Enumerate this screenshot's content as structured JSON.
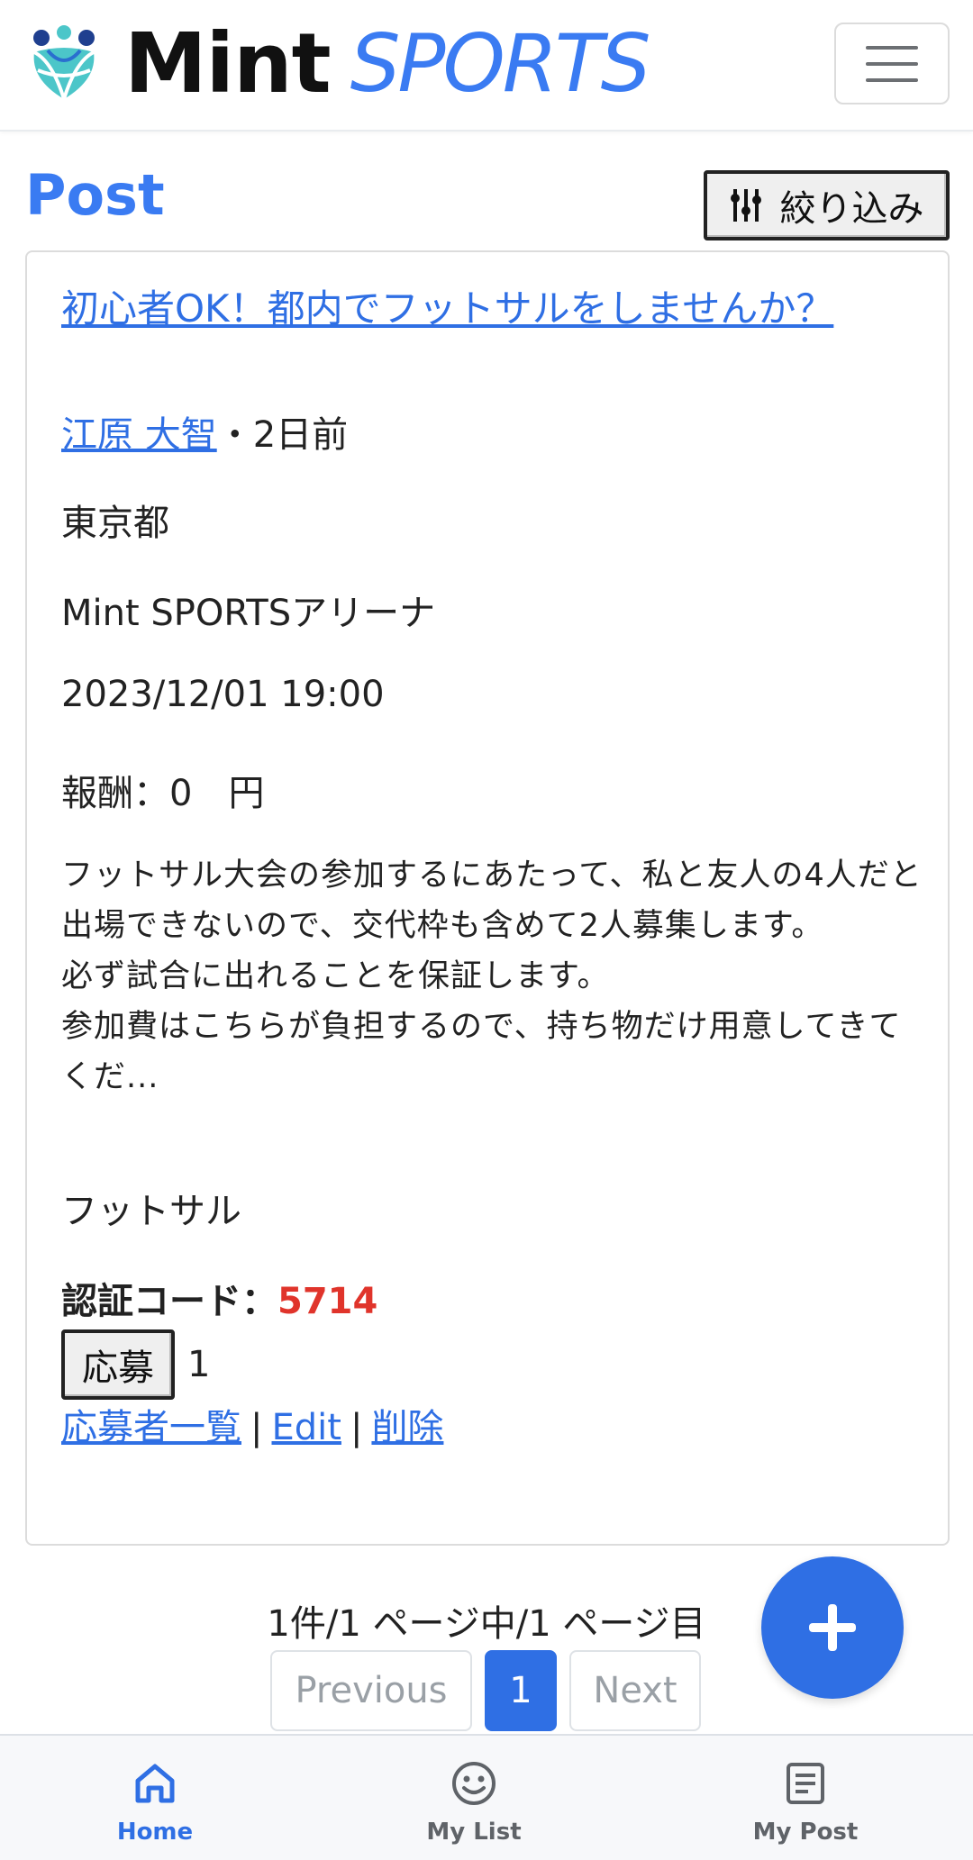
{
  "header": {
    "brand_mint": "Mint",
    "brand_sports": "SPORTS",
    "menu_icon": "hamburger-menu-icon"
  },
  "page": {
    "title": "Post",
    "filter_label": "絞り込み",
    "filter_icon": "sliders-icon"
  },
  "post": {
    "title": "初心者OK！都内でフットサルをしませんか？",
    "author": "江原 大智",
    "time_ago": "・2日前",
    "prefecture": "東京都",
    "venue": "Mint SPORTSアリーナ",
    "datetime": "2023/12/01 19:00",
    "reward": "報酬：0　円",
    "description": "フットサル大会の参加するにあたって、私と友人の4人だと出場できないので、交代枠も含めて2人募集します。\n必ず試合に出れることを保証します。\n参加費はこちらが負担するので、持ち物だけ用意してきてくだ...",
    "sport": "フットサル",
    "auth_label": "認証コード：",
    "auth_code": "5714",
    "apply_label": "応募",
    "apply_count": "1",
    "links": {
      "applicants": "応募者一覧",
      "sep1": "|",
      "edit": "Edit",
      "sep2": "|",
      "delete": "削除"
    }
  },
  "pagination": {
    "info": "1件/1 ページ中/1 ページ目",
    "previous": "Previous",
    "current": "1",
    "next": "Next"
  },
  "fab_icon": "plus-icon",
  "bottom_nav": [
    {
      "label": "Home",
      "icon": "home-icon",
      "active": true
    },
    {
      "label": "My List",
      "icon": "smiley-icon",
      "active": false
    },
    {
      "label": "My Post",
      "icon": "document-icon",
      "active": false
    }
  ],
  "colors": {
    "accent": "#2f6fe4",
    "brand_blue": "#3a7bf2",
    "auth_code": "#e0342b"
  }
}
